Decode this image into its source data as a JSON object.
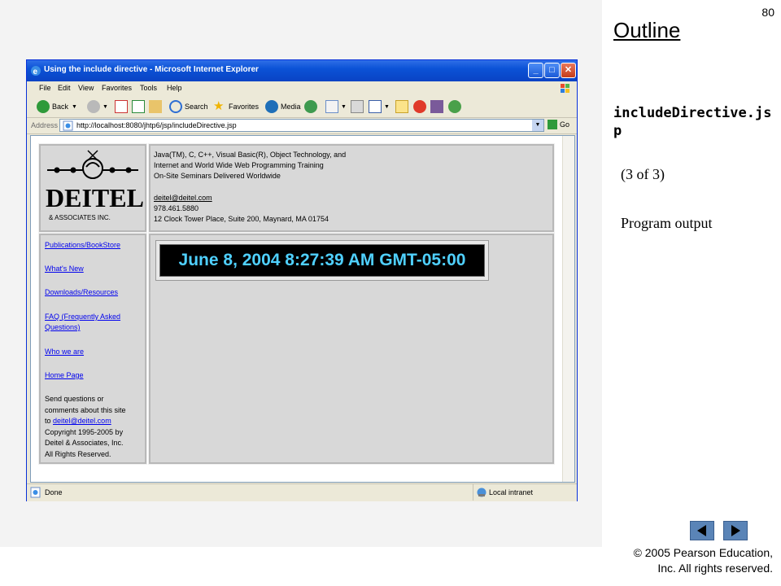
{
  "slide": {
    "page_number": "80",
    "outline_title": "Outline",
    "filename": "includeDirective.jsp",
    "part_label": "(3 of 3)",
    "output_label": "Program output",
    "copyright_line1": "© 2005 Pearson Education,",
    "copyright_line2": "Inc.  All rights reserved."
  },
  "browser": {
    "title": "Using the include directive - Microsoft Internet Explorer",
    "menu": [
      "File",
      "Edit",
      "View",
      "Favorites",
      "Tools",
      "Help"
    ],
    "toolbar": {
      "back": "Back",
      "search": "Search",
      "favorites": "Favorites",
      "media": "Media"
    },
    "address": {
      "label": "Address",
      "url": "http://localhost:8080/jhtp6/jsp/includeDirective.jsp",
      "go": "Go"
    },
    "status": {
      "text": "Done",
      "zone": "Local intranet"
    }
  },
  "page": {
    "logo": {
      "main": "DEITEL",
      "sub": "& ASSOCIATES INC."
    },
    "header_lines": [
      "Java(TM), C, C++, Visual Basic(R), Object Technology, and",
      "Internet and World Wide Web Programming Training",
      "On-Site Seminars Delivered Worldwide"
    ],
    "email": "deitel@deitel.com",
    "phone": "978.461.5880",
    "address": "12 Clock Tower Place, Suite 200, Maynard, MA 01754",
    "nav_links": [
      "Publications/BookStore",
      "What's New",
      "Downloads/Resources",
      "FAQ (Frequently Asked",
      "Questions)",
      "Who we are",
      "Home Page"
    ],
    "contact": {
      "line1": "Send questions or",
      "line2": "comments about this site",
      "line3_prefix": "to ",
      "email": "deitel@deitel.com",
      "line4": "Copyright 1995-2005 by",
      "line5": "Deitel & Associates, Inc.",
      "line6": "All Rights Reserved."
    },
    "clock": "June 8, 2004 8:27:39 AM GMT-05:00"
  },
  "colors": {
    "clock_text": "#4fd0ff",
    "titlebar": "#0b52d6",
    "link": "#0000ee",
    "nav_button": "#5a84b7"
  }
}
